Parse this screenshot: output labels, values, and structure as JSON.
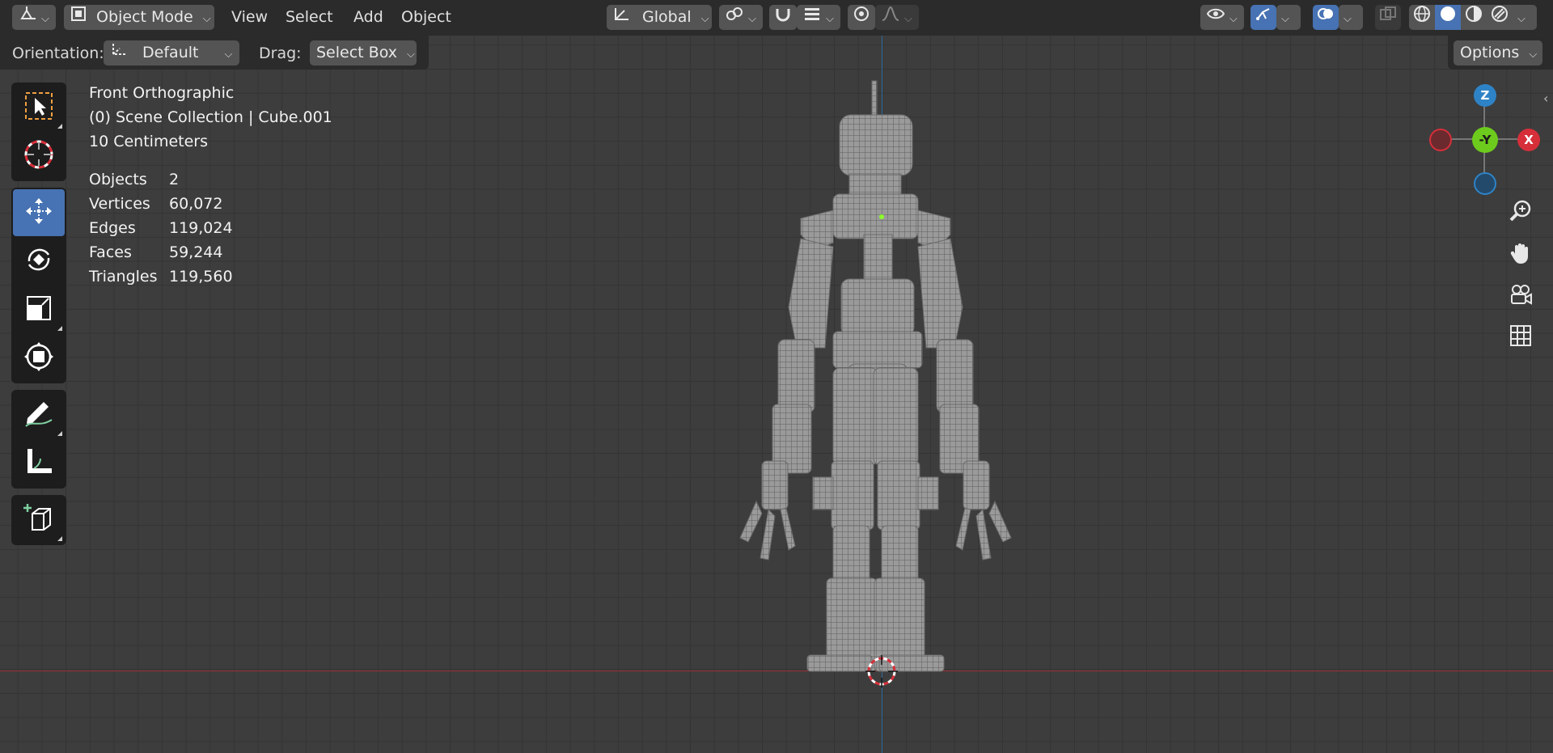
{
  "header": {
    "mode_label": "Object Mode",
    "menus": [
      "View",
      "Select",
      "Add",
      "Object"
    ],
    "transform_orientation": "Global"
  },
  "tool_settings": {
    "orientation_label": "Orientation:",
    "orientation_value": "Default",
    "drag_label": "Drag:",
    "drag_value": "Select Box",
    "options_label": "Options"
  },
  "viewport": {
    "view_name": "Front Orthographic",
    "collection_line": "(0) Scene Collection | Cube.001",
    "scale_line": "10 Centimeters",
    "stats": [
      {
        "label": "Objects",
        "value": "2"
      },
      {
        "label": "Vertices",
        "value": "60,072"
      },
      {
        "label": "Edges",
        "value": "119,024"
      },
      {
        "label": "Faces",
        "value": "59,244"
      },
      {
        "label": "Triangles",
        "value": "119,560"
      }
    ]
  },
  "gizmo": {
    "z": "Z",
    "y": "-Y",
    "x": "X"
  },
  "colors": {
    "accent_blue": "#4772b3",
    "axis_x": "#d62f3a",
    "axis_y": "#6dcb1d",
    "axis_z": "#2e83c6"
  },
  "tools": [
    "select-box-icon",
    "cursor-icon",
    "move-icon",
    "rotate-icon",
    "scale-icon",
    "transform-icon",
    "annotate-icon",
    "measure-icon",
    "add-cube-icon"
  ]
}
